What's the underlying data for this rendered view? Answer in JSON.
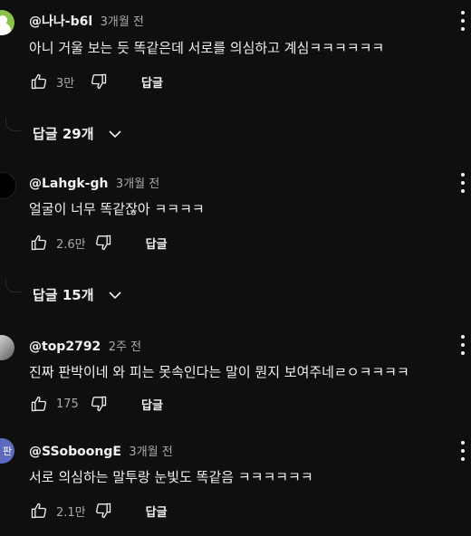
{
  "comments": [
    {
      "author": "@나나-b6l",
      "time": "3개월 전",
      "text": "아니 거울 보는 듯 똑같은데 서로를 의심하고 계심ㅋㅋㅋㅋㅋㅋ",
      "likes": "3만",
      "reply_label": "답글",
      "replies": "답글 29개",
      "avatar_icon": "person-icon"
    },
    {
      "author": "@Lahgk-gh",
      "time": "3개월 전",
      "text": "얼굴이 너무 똑같잖아 ㅋㅋㅋㅋ",
      "likes": "2.6만",
      "reply_label": "답글",
      "replies": "답글 15개",
      "avatar_icon": "avatar-icon"
    },
    {
      "author": "@top2792",
      "time": "2주 전",
      "text": "진짜 판박이네 와 피는 못속인다는 말이 뭔지 보여주네ㄹㅇㅋㅋㅋㅋ",
      "likes": "175",
      "reply_label": "답글",
      "avatar_icon": "photo-avatar-icon"
    },
    {
      "author": "@SSoboongE",
      "time": "3개월 전",
      "text": "서로 의심하는 말투랑 눈빛도 똑같음 ㅋㅋㅋㅋㅋㅋ",
      "likes": "2.1만",
      "reply_label": "답글",
      "avatar_letter": "판"
    }
  ],
  "colors": {
    "background": "#0f0f0f",
    "text": "#f1f1f1",
    "muted": "#aaaaaa"
  }
}
